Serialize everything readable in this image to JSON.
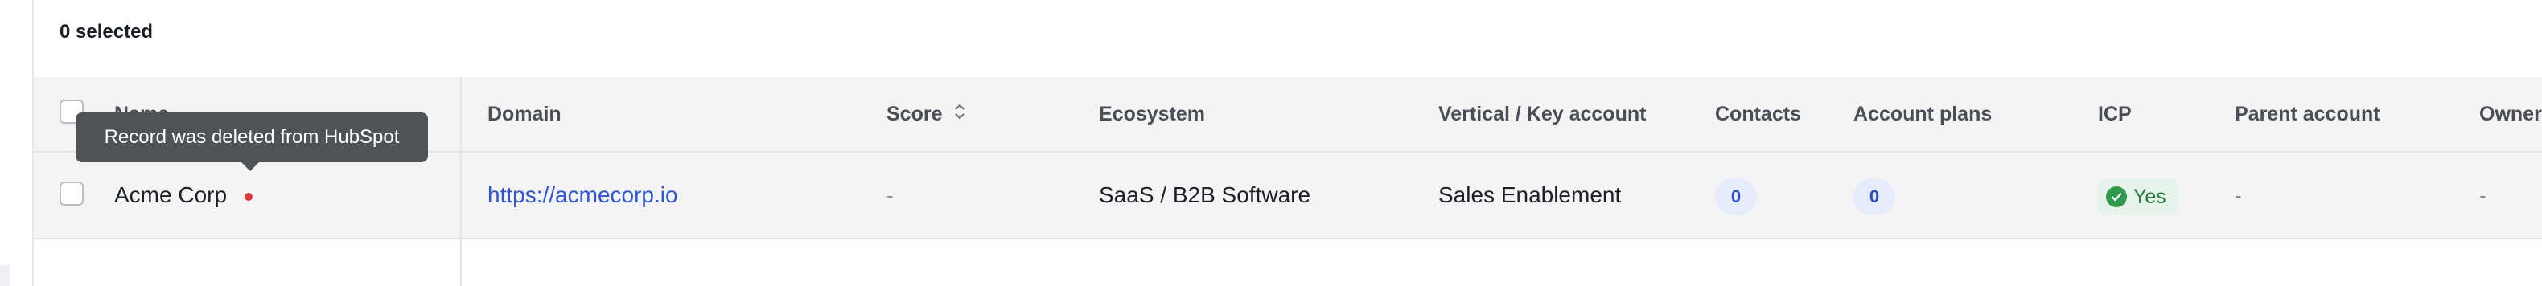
{
  "toolbar": {
    "selected_count": "0 selected"
  },
  "table": {
    "headers": {
      "name": "Name",
      "domain": "Domain",
      "score": "Score",
      "ecosystem": "Ecosystem",
      "vertical": "Vertical / Key account",
      "contacts": "Contacts",
      "account_plans": "Account plans",
      "icp": "ICP",
      "parent_account": "Parent account",
      "owner": "Owner"
    },
    "rows": [
      {
        "name": "Acme Corp",
        "domain": "https://acmecorp.io",
        "score": "-",
        "ecosystem": "SaaS / B2B Software",
        "vertical": "Sales Enablement",
        "contacts": "0",
        "account_plans": "0",
        "icp": "Yes",
        "parent_account": "-",
        "owner": "-"
      }
    ]
  },
  "tooltip": {
    "text": "Record was deleted from HubSpot"
  },
  "icons": {
    "sort": "sort-updown-icon",
    "check": "check-circle-icon",
    "status": "deleted-status-dot"
  },
  "colors": {
    "link": "#2d55d6",
    "icp_green": "#2f9a4c",
    "status_red": "#e0343b",
    "pill_blue": "#2d4fc4"
  }
}
